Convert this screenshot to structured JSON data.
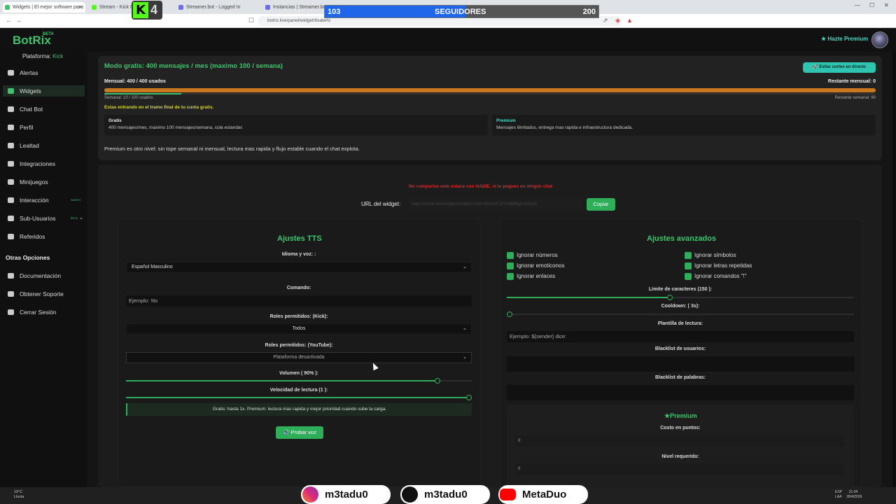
{
  "browser": {
    "tabs": [
      "Widgets | El mejor software para",
      "Stream - Kick Dash",
      "Streamer.bot - Logged In",
      "Instancias | Streamer.bot"
    ],
    "url": "botrix.live/panel/widget/ttsalerts"
  },
  "overlay": {
    "kick_count": "4",
    "followers_current": "103",
    "followers_label": "SEGUIDORES",
    "followers_goal": "200",
    "followers_progress": 0.515
  },
  "header": {
    "logo": "BotRix",
    "logo_badge": "BETA",
    "premium_link": "Hazte Premium"
  },
  "sidebar": {
    "platform_label": "Plataforma:",
    "platform_value": "Kick",
    "items": [
      {
        "label": "Alertas"
      },
      {
        "label": "Widgets"
      },
      {
        "label": "Chat Bot"
      },
      {
        "label": "Perfil"
      },
      {
        "label": "Lealtad"
      },
      {
        "label": "Integraciones"
      },
      {
        "label": "Minijuegos"
      },
      {
        "label": "Interacción",
        "tag": "NUEVO"
      },
      {
        "label": "Sub-Usuarios",
        "tag": "BETA"
      },
      {
        "label": "Referidos"
      }
    ],
    "other_heading": "Otras Opciones",
    "other_items": [
      {
        "label": "Documentación"
      },
      {
        "label": "Obtener Soporte"
      },
      {
        "label": "Cerrar Sesión"
      }
    ]
  },
  "quota": {
    "title": "Modo gratis: 400 mensajes / mes (maximo 100 / semana)",
    "cortes_button": "Evitar cortes en directo",
    "monthly_label": "Mensual: 400 / 400 usados",
    "monthly_remaining": "Restante mensual: 0",
    "monthly_progress": 1.0,
    "weekly_label": "Semanal: 10 / 100 usados",
    "weekly_remaining": "Restante semanal: 90",
    "weekly_progress": 0.1,
    "warning": "Estas entrando en el tramo final de tu cuota gratis.",
    "free_plan_title": "Gratis",
    "free_plan_desc": "400 mensajes/mes, maximo 100 mensajes/semana, cola estandar.",
    "premium_plan_title": "Premium",
    "premium_plan_desc": "Mensajes ilimitados, entrega mas rapida e infraestructura dedicada.",
    "premium_note": "Premium es otro nivel: sin tope semanal ni mensual, lectura mas rapida y flujo estable cuando el chat explota."
  },
  "widget_url": {
    "warning": "No compartas este enlace con NADIE, ni lo pegues en ningún chat",
    "label": "URL del widget:",
    "value": "https://botrix.live/widgets/ttsalerts?bid=9KdVJF3Z1rHBkRgnveRetG",
    "copy_button": "Copiar"
  },
  "tts": {
    "title": "Ajustes TTS",
    "voice_label": "Idioma y voz: :",
    "voice_value": "Español Masculino",
    "command_label": "Comando:",
    "command_placeholder": "Ejemplo: !tts",
    "roles_kick_label": "Roles permitidos: (Kick):",
    "roles_kick_value": "Todos",
    "roles_yt_label": "Roles permitidos: (YouTube):",
    "roles_yt_value": "Plataforma desactivada",
    "volume_label": "Volumen ( 90% ):",
    "volume_value": 0.9,
    "speed_label": "Velocidad de lectura (1 ):",
    "speed_value": 1.0,
    "speed_note": "Gratis: hasta 1x. Premium: lectura mas rapida y mejor prioridad cuando sube la carga.",
    "test_button": "Probar voz"
  },
  "advanced": {
    "title": "Ajustes avanzados",
    "checkboxes": [
      "Ignorar números",
      "Ignorar emoticonos",
      "Ignorar enlaces",
      "Ignorar símbolos",
      "Ignorar letras repetidas",
      "Ignorar comandos \"!\""
    ],
    "char_limit_label": "Límite de caracteres (150 ):",
    "char_limit_value": 0.47,
    "cooldown_label": "Cooldown: ( 3s):",
    "cooldown_value": 0.0,
    "template_label": "Plantilla de lectura:",
    "template_placeholder": "Ejemplo: ${sender} dice:",
    "blacklist_users_label": "Blacklist de usuarios:",
    "blacklist_words_label": "Blacklist de palabras:",
    "premium_title": "Premium",
    "cost_label": "Costo en puntos:",
    "cost_value": "0",
    "level_label": "Nivel requerido:",
    "level_value": "0"
  },
  "taskbar": {
    "weather_temp": "10°C",
    "weather_desc": "Lluvia",
    "lang": "ESP",
    "lang2": "LAA",
    "time": "21:04",
    "date": "28/4/2026"
  },
  "socials": [
    {
      "handle": "m3tadu0",
      "color": "#c13584"
    },
    {
      "handle": "m3tadu0",
      "color": "#111111"
    },
    {
      "handle": "MetaDuo",
      "color": "#ff0000"
    }
  ]
}
